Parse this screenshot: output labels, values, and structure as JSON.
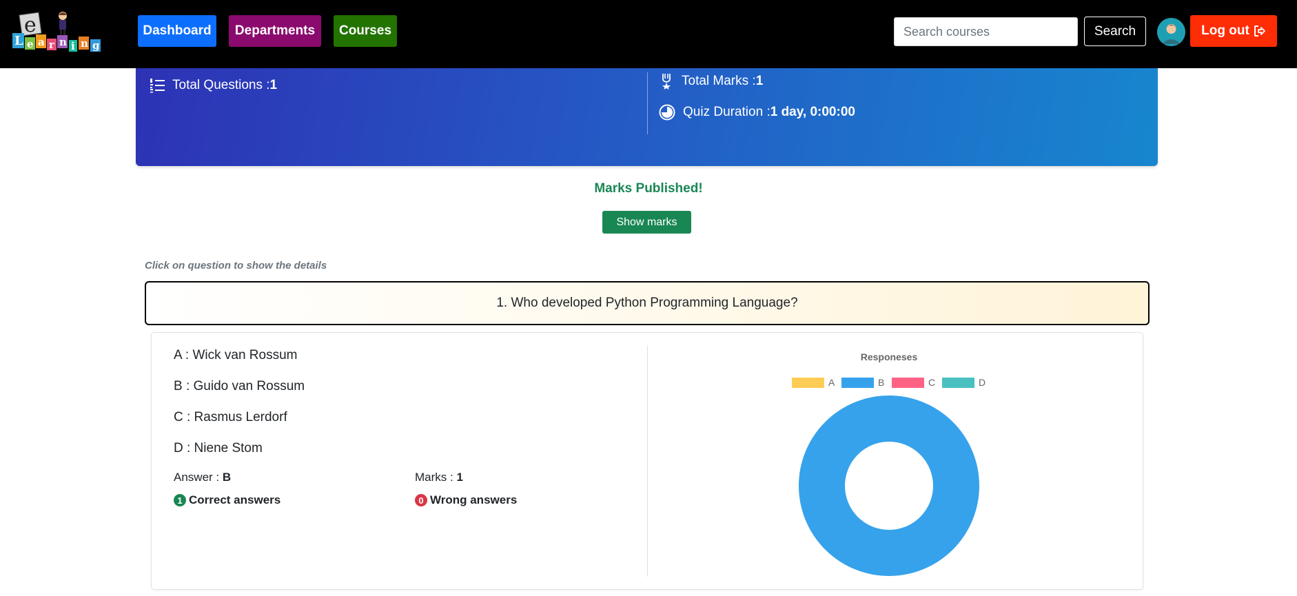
{
  "nav": {
    "logo_letters": "eLearning",
    "dashboard": "Dashboard",
    "departments": "Departments",
    "courses": "Courses",
    "search_placeholder": "Search courses",
    "search_button": "Search",
    "logout": "Log out",
    "colors": {
      "dashboard": "#0d6efd",
      "departments": "#8b0a6e",
      "courses": "#237300",
      "logout": "#ff2d06"
    }
  },
  "quiz": {
    "total_questions_label": "Total Questions : ",
    "total_questions": "1",
    "total_marks_label": "Total Marks : ",
    "total_marks": "1",
    "duration_label": "Quiz Duration : ",
    "duration": "1 day, 0:00:00"
  },
  "status": {
    "published": "Marks Published!",
    "show_marks": "Show marks",
    "hint": "Click on question to show the details"
  },
  "question": {
    "text": "1. Who developed Python Programming Language?",
    "options": [
      "A : Wick van Rossum",
      "B : Guido van Rossum",
      "C : Rasmus Lerdorf",
      "D : Niene Stom"
    ],
    "answer_label": "Answer : ",
    "answer": "B",
    "marks_label": "Marks : ",
    "marks": "1",
    "correct_count": "1",
    "correct_label": "Correct answers",
    "wrong_count": "0",
    "wrong_label": "Wrong answers"
  },
  "chart_data": {
    "type": "pie",
    "title": "Responeses",
    "categories": [
      "A",
      "B",
      "C",
      "D"
    ],
    "values": [
      0,
      1,
      0,
      0
    ],
    "colors": [
      "#ffcd56",
      "#36a2eb",
      "#ff6384",
      "#4bc0c0"
    ],
    "donut": true,
    "legend": "top"
  }
}
